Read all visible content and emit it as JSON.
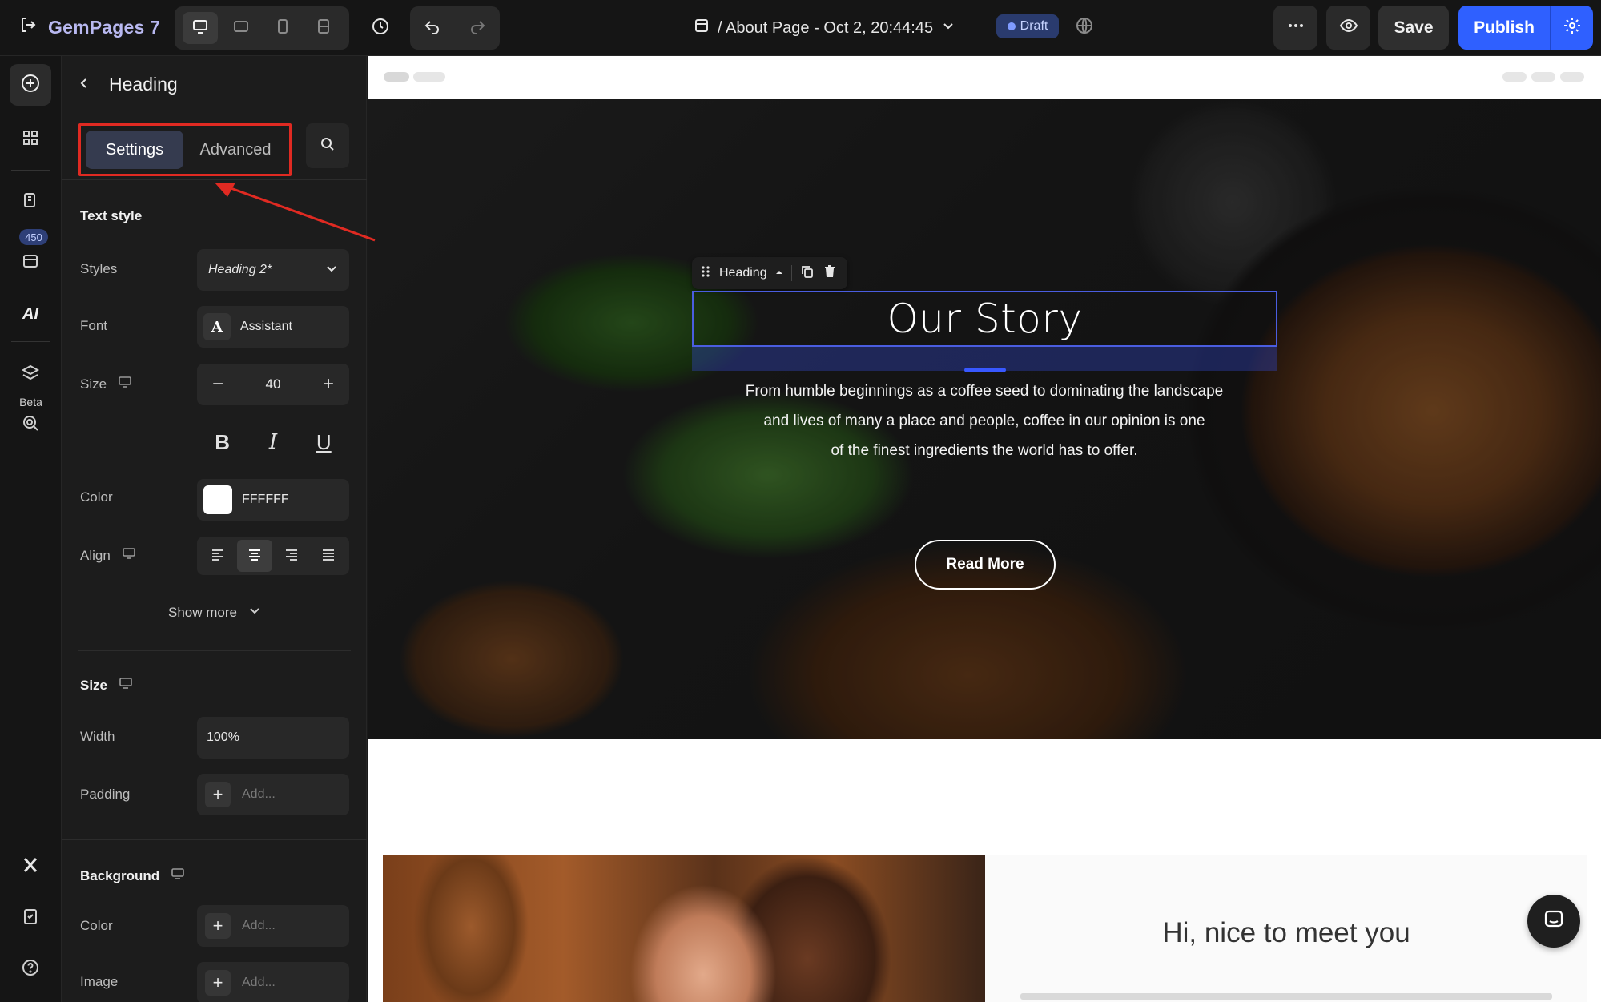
{
  "app": {
    "brand": "GemPages 7"
  },
  "topbar": {
    "page_title": "/ About Page - Oct 2, 20:44:45",
    "status": "Draft",
    "save_label": "Save",
    "publish_label": "Publish"
  },
  "rail": {
    "badge": "450",
    "beta_label": "Beta",
    "ai_label": "AI"
  },
  "panel": {
    "title": "Heading",
    "tabs": [
      {
        "label": "Settings",
        "active": true
      },
      {
        "label": "Advanced",
        "active": false
      }
    ],
    "text_style": {
      "title": "Text style",
      "styles_label": "Styles",
      "styles_value": "Heading 2*",
      "font_label": "Font",
      "font_value": "Assistant",
      "size_label": "Size",
      "size_value": "40",
      "color_label": "Color",
      "color_value": "FFFFFF",
      "align_label": "Align",
      "show_more": "Show more"
    },
    "size_section": {
      "title": "Size",
      "width_label": "Width",
      "width_value": "100%",
      "padding_label": "Padding",
      "padding_placeholder": "Add..."
    },
    "background_section": {
      "title": "Background",
      "color_label": "Color",
      "color_placeholder": "Add...",
      "image_label": "Image",
      "image_placeholder": "Add..."
    }
  },
  "canvas": {
    "chip_label": "Heading",
    "heading": "Our Story",
    "hero_lines": [
      "From humble beginnings as a coffee seed to dominating the landscape",
      "and lives of many a place and people, coffee in our opinion is one",
      "of the finest ingredients the world has to offer."
    ],
    "button_label": "Read More",
    "lower_heading": "Hi, nice to meet you"
  },
  "colors": {
    "accent": "#2f60ff",
    "selection": "#4a5de0",
    "highlight": "#e02a22",
    "heading_text": "#FFFFFF"
  }
}
